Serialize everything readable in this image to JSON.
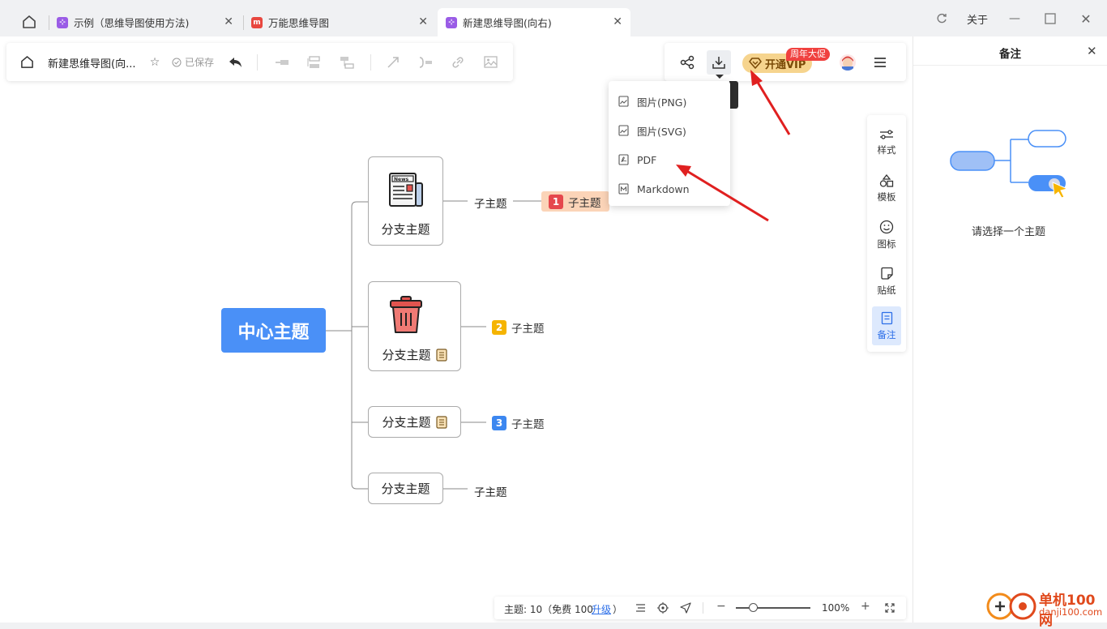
{
  "tabs": {
    "home_icon": "home-icon",
    "items": [
      {
        "label": "示例（思维导图使用方法)",
        "icon_color": "#9a5ce6"
      },
      {
        "label": "万能思维导图",
        "icon_color": "#e8473f"
      },
      {
        "label": "新建思维导图(向右)",
        "icon_color": "#9a5ce6"
      }
    ]
  },
  "window": {
    "about_label": "关于"
  },
  "toolbar": {
    "doc_title": "新建思维导图(向...",
    "saved_label": "已保存"
  },
  "toolbar_right": {
    "vip_label": "开通VIP",
    "promo_label": "周年大促"
  },
  "export_menu": {
    "items": [
      "图片(PNG)",
      "图片(SVG)",
      "PDF",
      "Markdown"
    ]
  },
  "mindmap": {
    "root": "中心主题",
    "branches": [
      {
        "label": "分支主题",
        "child": "子主题",
        "badge": "1",
        "badge_color": "#e5484d",
        "child2": "子主题"
      },
      {
        "label": "分支主题",
        "child": "子主题",
        "badge": "2",
        "badge_color": "#f5b400"
      },
      {
        "label": "分支主题",
        "child": "子主题",
        "badge": "3",
        "badge_color": "#3c87f0"
      },
      {
        "label": "分支主题",
        "child": "子主题"
      }
    ]
  },
  "sidebar": {
    "items": [
      {
        "label": "样式",
        "icon": "style-sliders-icon"
      },
      {
        "label": "模板",
        "icon": "template-shapes-icon"
      },
      {
        "label": "图标",
        "icon": "smiley-icon"
      },
      {
        "label": "贴纸",
        "icon": "sticker-icon"
      },
      {
        "label": "备注",
        "icon": "note-icon"
      }
    ]
  },
  "right_panel": {
    "title": "备注",
    "empty_text": "请选择一个主题"
  },
  "statusbar": {
    "topic_count": "主题: 10（免费 100",
    "upgrade": "升级",
    "close_paren": "）",
    "zoom": "100%"
  },
  "watermark": {
    "cn": "单机100网",
    "url": "danji100.com"
  },
  "colors": {
    "accent": "#4a90f7",
    "arrow": "#e02020"
  }
}
